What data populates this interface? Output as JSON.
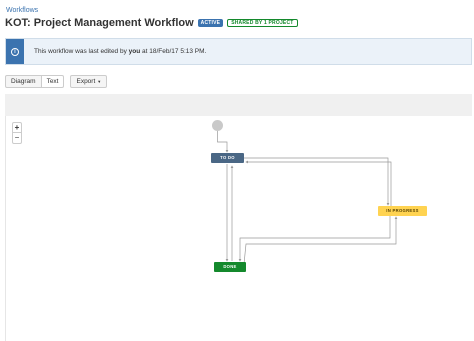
{
  "breadcrumb": {
    "label": "Workflows"
  },
  "header": {
    "title": "KOT: Project Management Workflow",
    "status_lozenge": "ACTIVE",
    "shared_lozenge": "SHARED BY 1 PROJECT"
  },
  "info_banner": {
    "prefix": "This workflow was last edited by ",
    "user": "you",
    "suffix": " at 18/Feb/17 5:13 PM."
  },
  "toolbar": {
    "view_diagram": "Diagram",
    "view_text": "Text",
    "export_label": "Export"
  },
  "zoom": {
    "in": "+",
    "out": "−"
  },
  "workflow": {
    "statuses": [
      {
        "label": "TO DO",
        "color": "#4a6785"
      },
      {
        "label": "IN PROGRESS",
        "color": "#ffd351"
      },
      {
        "label": "DONE",
        "color": "#14892c"
      }
    ]
  },
  "colors": {
    "accent": "#3b73af",
    "banner_bg": "#ebf2f9",
    "done": "#14892c"
  }
}
